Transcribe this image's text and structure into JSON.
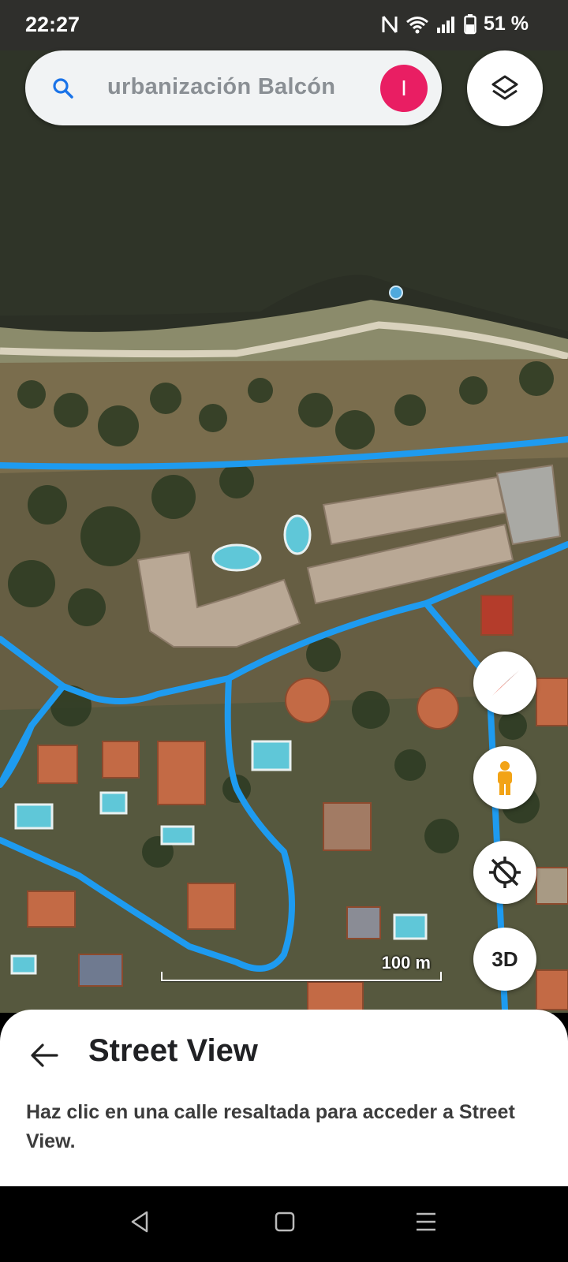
{
  "status_bar": {
    "time": "22:27",
    "battery": "51 %",
    "icons": [
      "nfc-icon",
      "wifi-icon",
      "signal-icon",
      "battery-icon"
    ]
  },
  "search": {
    "query": "urbanización Balcón",
    "avatar_initial": "I",
    "avatar_color": "#e91e63"
  },
  "map": {
    "scale_label": "100 m",
    "controls": [
      "compass-icon",
      "pegman-icon",
      "location-off-icon",
      "3D"
    ],
    "three_d_label": "3D",
    "street_view_line_color": "#1e9bf0"
  },
  "sheet": {
    "title": "Street View",
    "description": "Haz clic en una calle resaltada para acceder a Street View."
  },
  "nav_bar": {
    "buttons": [
      "back-icon",
      "home-icon",
      "menu-icon"
    ]
  }
}
